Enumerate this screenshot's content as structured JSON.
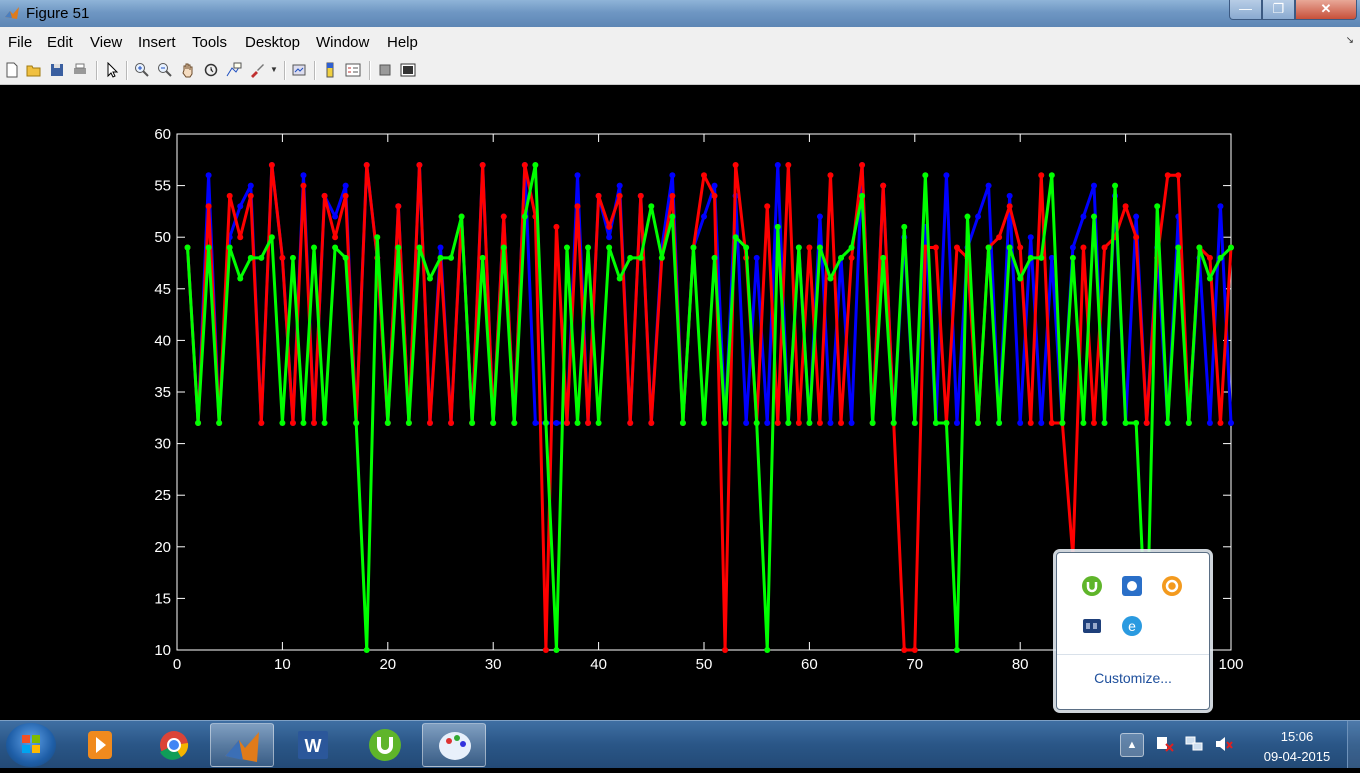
{
  "window": {
    "title": "Figure 51",
    "min_glyph": "—",
    "max_glyph": "❐",
    "close_glyph": "✕"
  },
  "menu": {
    "items": [
      "File",
      "Edit",
      "View",
      "Insert",
      "Tools",
      "Desktop",
      "Window",
      "Help"
    ],
    "dock_glyph": "↘"
  },
  "toolbar": {
    "icons": [
      "new-figure-icon",
      "open-file-icon",
      "save-icon",
      "print-icon",
      "edit-plot-arrow-icon",
      "zoom-in-icon",
      "zoom-out-icon",
      "pan-hand-icon",
      "rotate-3d-icon",
      "data-cursor-icon",
      "brush-icon",
      "link-plot-icon",
      "colorbar-icon",
      "legend-icon",
      "hide-plot-tools-icon",
      "show-plot-tools-icon"
    ]
  },
  "chart_data": {
    "type": "line",
    "xlim": [
      0,
      100
    ],
    "ylim": [
      10,
      60
    ],
    "xticks": [
      0,
      10,
      20,
      30,
      40,
      50,
      60,
      70,
      80,
      90,
      100
    ],
    "yticks": [
      10,
      15,
      20,
      25,
      30,
      35,
      40,
      45,
      50,
      55,
      60
    ],
    "x": [
      1,
      2,
      3,
      4,
      5,
      6,
      7,
      8,
      9,
      10,
      11,
      12,
      13,
      14,
      15,
      16,
      17,
      18,
      19,
      20,
      21,
      22,
      23,
      24,
      25,
      26,
      27,
      28,
      29,
      30,
      31,
      32,
      33,
      34,
      35,
      36,
      37,
      38,
      39,
      40,
      41,
      42,
      43,
      44,
      45,
      46,
      47,
      48,
      49,
      50,
      51,
      52,
      53,
      54,
      55,
      56,
      57,
      58,
      59,
      60,
      61,
      62,
      63,
      64,
      65,
      66,
      67,
      68,
      69,
      70,
      71,
      72,
      73,
      74,
      75,
      76,
      77,
      78,
      79,
      80,
      81,
      82,
      83,
      84,
      85,
      86,
      87,
      88,
      89,
      90,
      91,
      92,
      93,
      94,
      95,
      96,
      97,
      98,
      99,
      100
    ],
    "series": [
      {
        "color": "#0000ff",
        "values": [
          49,
          32,
          56,
          32,
          50,
          53,
          55,
          32,
          57,
          48,
          32,
          56,
          32,
          54,
          52,
          55,
          32,
          57,
          48,
          32,
          53,
          32,
          57,
          32,
          49,
          32,
          52,
          32,
          57,
          32,
          52,
          32,
          57,
          32,
          32,
          32,
          32,
          56,
          32,
          54,
          50,
          55,
          32,
          54,
          32,
          49,
          56,
          32,
          49,
          52,
          55,
          32,
          54,
          32,
          48,
          32,
          57,
          32,
          49,
          32,
          52,
          32,
          48,
          32,
          57,
          32,
          55,
          32,
          50,
          32,
          51,
          32,
          56,
          32,
          49,
          52,
          55,
          32,
          54,
          32,
          50,
          32,
          48,
          32,
          49,
          52,
          55,
          32,
          54,
          32,
          52,
          32,
          49,
          32,
          52,
          32,
          48,
          32,
          53,
          32
        ]
      },
      {
        "color": "#ff0000",
        "values": [
          49,
          32,
          53,
          32,
          54,
          50,
          54,
          32,
          57,
          48,
          32,
          55,
          32,
          54,
          50,
          54,
          32,
          57,
          48,
          32,
          53,
          32,
          57,
          32,
          48,
          32,
          52,
          32,
          57,
          32,
          52,
          32,
          57,
          52,
          10,
          51,
          32,
          53,
          32,
          54,
          51,
          54,
          32,
          54,
          32,
          48,
          54,
          32,
          49,
          56,
          54,
          10,
          57,
          48,
          32,
          53,
          32,
          57,
          32,
          49,
          32,
          56,
          32,
          48,
          57,
          32,
          55,
          32,
          10,
          10,
          49,
          49,
          32,
          49,
          48,
          32,
          49,
          50,
          53,
          49,
          32,
          56,
          32,
          32,
          19,
          49,
          32,
          49,
          50,
          53,
          50,
          32,
          48,
          56,
          56,
          32,
          49,
          48,
          32,
          49
        ]
      },
      {
        "color": "#00ff00",
        "values": [
          49,
          32,
          49,
          32,
          49,
          46,
          48,
          48,
          50,
          32,
          48,
          32,
          49,
          32,
          49,
          48,
          32,
          10,
          50,
          32,
          49,
          32,
          49,
          46,
          48,
          48,
          52,
          32,
          48,
          32,
          49,
          32,
          52,
          57,
          32,
          10,
          49,
          32,
          49,
          32,
          49,
          46,
          48,
          48,
          53,
          48,
          52,
          32,
          49,
          32,
          48,
          32,
          50,
          49,
          32,
          10,
          51,
          32,
          49,
          32,
          49,
          46,
          48,
          49,
          54,
          32,
          48,
          32,
          51,
          32,
          56,
          32,
          32,
          10,
          52,
          32,
          49,
          32,
          49,
          46,
          48,
          48,
          56,
          32,
          48,
          32,
          52,
          32,
          55,
          32,
          32,
          10,
          53,
          32,
          49,
          32,
          49,
          46,
          48,
          49
        ]
      }
    ]
  },
  "tray_popup": {
    "customize_label": "Customize...",
    "icons": [
      "utorrent-icon",
      "control-panel-icon",
      "avast-icon",
      "media-icon",
      "internet-explorer-icon"
    ]
  },
  "taskbar": {
    "apps": [
      "media-player-icon",
      "chrome-icon",
      "matlab-icon",
      "word-icon",
      "utorrent-icon",
      "paint-icon"
    ],
    "time": "15:06",
    "date": "09-04-2015"
  }
}
